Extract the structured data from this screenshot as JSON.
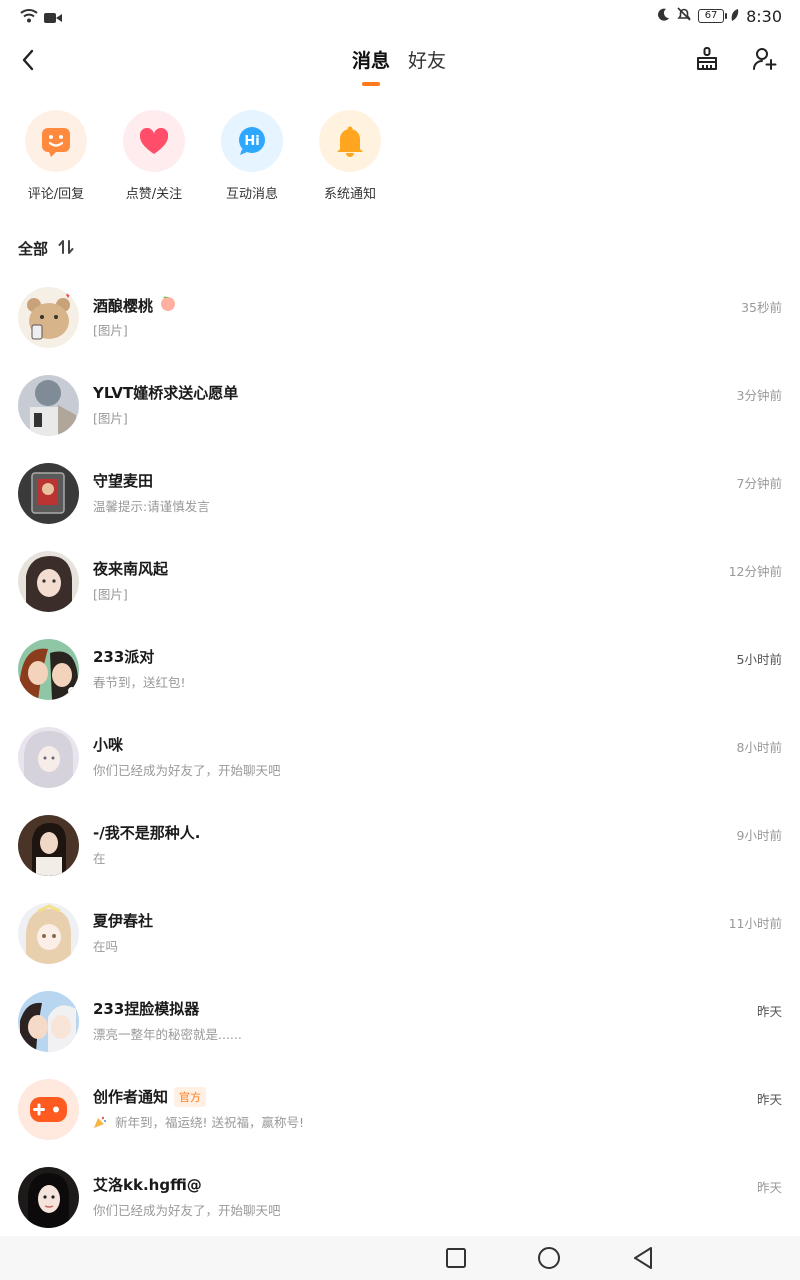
{
  "status": {
    "battery": "67",
    "time": "8:30"
  },
  "header": {
    "tabs": [
      {
        "label": "消息",
        "active": true
      },
      {
        "label": "好友",
        "active": false
      }
    ]
  },
  "shortcuts": [
    {
      "label": "评论/回复",
      "icon": "comment-face-icon",
      "color": "#ff8a3d",
      "bg": "#fff0e6"
    },
    {
      "label": "点赞/关注",
      "icon": "heart-icon",
      "color": "#ff4d6a",
      "bg": "#ffecef"
    },
    {
      "label": "互动消息",
      "icon": "hi-bubble-icon",
      "color": "#2ea7ff",
      "bg": "#e6f4ff"
    },
    {
      "label": "系统通知",
      "icon": "bell-icon",
      "color": "#ffa51f",
      "bg": "#fff3e0"
    }
  ],
  "section": {
    "title": "全部"
  },
  "conversations": [
    {
      "name": "酒酿樱桃",
      "preview": "[图片]",
      "time": "35秒前",
      "time_dark": false
    },
    {
      "name": "YLVT嫤桥求送心愿单",
      "preview": "[图片]",
      "time": "3分钟前",
      "time_dark": false
    },
    {
      "name": "守望麦田",
      "preview": "温馨提示:请谨慎发言",
      "time": "7分钟前",
      "time_dark": false
    },
    {
      "name": "夜来南风起",
      "preview": "[图片]",
      "time": "12分钟前",
      "time_dark": false
    },
    {
      "name": "233派对",
      "preview": "春节到，送红包!",
      "time": "5小时前",
      "time_dark": true
    },
    {
      "name": "小咪",
      "preview": "你们已经成为好友了，开始聊天吧",
      "time": "8小时前",
      "time_dark": false
    },
    {
      "name": "-/我不是那种人.",
      "preview": "在",
      "time": "9小时前",
      "time_dark": false
    },
    {
      "name": "夏伊春社",
      "preview": "在吗",
      "time": "11小时前",
      "time_dark": false
    },
    {
      "name": "233捏脸模拟器",
      "preview": "漂亮一整年的秘密就是......",
      "time": "昨天",
      "time_dark": true
    },
    {
      "name": "创作者通知",
      "badge": "官方",
      "preview": "新年到，福运绕!  送祝福，赢称号!",
      "time": "昨天",
      "time_dark": true
    },
    {
      "name": "艾洛kk.hgffi@",
      "preview": "你们已经成为好友了，开始聊天吧",
      "time": "昨天",
      "time_dark": false
    }
  ],
  "colors": {
    "accent": "#ff7a1a",
    "text_secondary": "#999999"
  }
}
